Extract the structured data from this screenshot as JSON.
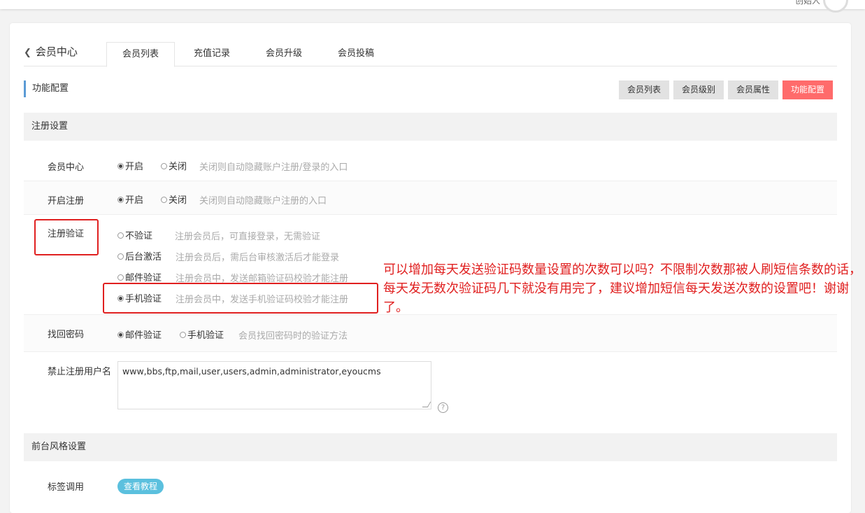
{
  "topbar": {
    "user_label": "创始人"
  },
  "header": {
    "back_label": "会员中心",
    "tabs": [
      {
        "label": "会员列表",
        "active": true
      },
      {
        "label": "充值记录"
      },
      {
        "label": "会员升级"
      },
      {
        "label": "会员投稿"
      }
    ]
  },
  "section": {
    "title": "功能配置",
    "buttons": [
      {
        "label": "会员列表"
      },
      {
        "label": "会员级别"
      },
      {
        "label": "会员属性"
      },
      {
        "label": "功能配置",
        "active": true
      }
    ]
  },
  "register_settings": {
    "title": "注册设置",
    "member_center": {
      "label": "会员中心",
      "options": [
        "开启",
        "关闭"
      ],
      "selected": "开启",
      "hint": "关闭则自动隐藏账户注册/登录的入口"
    },
    "open_register": {
      "label": "开启注册",
      "options": [
        "开启",
        "关闭"
      ],
      "selected": "开启",
      "hint": "关闭则自动隐藏账户注册的入口"
    },
    "register_verify": {
      "label": "注册验证",
      "options": [
        {
          "label": "不验证",
          "hint": "注册会员后，可直接登录，无需验证"
        },
        {
          "label": "后台激活",
          "hint": "注册会员后，需后台审核激活后才能登录"
        },
        {
          "label": "邮件验证",
          "hint": "注册会员中，发送邮箱验证码校验才能注册"
        },
        {
          "label": "手机验证",
          "hint": "注册会员中，发送手机验证码校验才能注册"
        }
      ],
      "selected": "手机验证"
    },
    "retrieve_password": {
      "label": "找回密码",
      "options": [
        "邮件验证",
        "手机验证"
      ],
      "selected": "邮件验证",
      "hint": "会员找回密码时的验证方法"
    },
    "banned_usernames": {
      "label": "禁止注册用户名",
      "value": "www,bbs,ftp,mail,user,users,admin,administrator,eyoucms",
      "help": "?"
    }
  },
  "frontend_style": {
    "title": "前台风格设置",
    "tag_call": {
      "label": "标签调用",
      "button_label": "查看教程"
    }
  },
  "annotation": {
    "text": "可以增加每天发送验证码数量设置的次数可以吗？不限制次数那被人刷短信条数的话，每天发无数次验证码几下就没有用完了，建议增加短信每天发送次数的设置吧！谢谢了。",
    "color": "#e02020"
  }
}
